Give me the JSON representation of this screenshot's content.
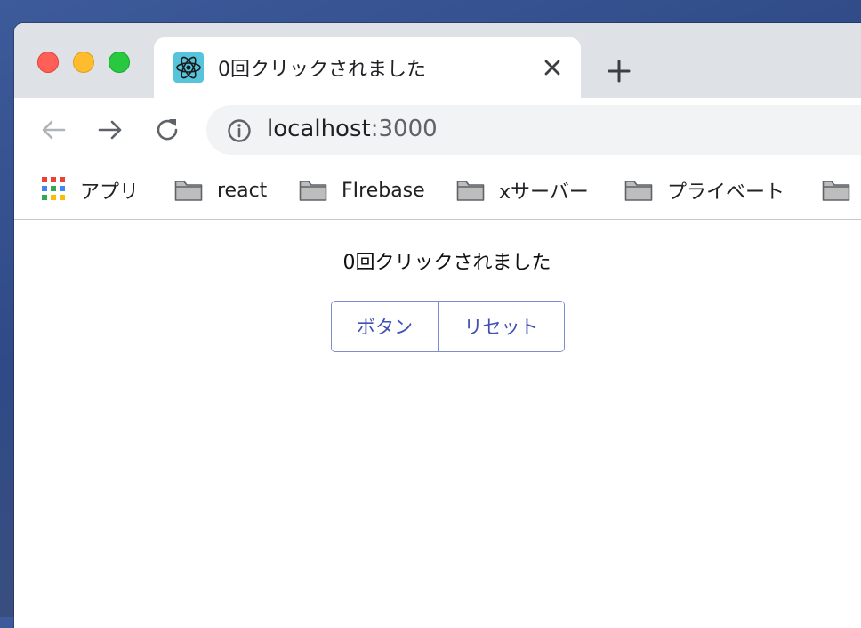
{
  "tab": {
    "title": "0回クリックされました",
    "favicon": "react-icon"
  },
  "address_bar": {
    "host": "localhost",
    "port": ":3000"
  },
  "bookmarks": [
    {
      "label": "アプリ",
      "icon": "apps-grid-icon"
    },
    {
      "label": "react",
      "icon": "folder-icon"
    },
    {
      "label": "FIrebase",
      "icon": "folder-icon"
    },
    {
      "label": "xサーバー",
      "icon": "folder-icon"
    },
    {
      "label": "プライベート",
      "icon": "folder-icon"
    },
    {
      "label": "",
      "icon": "folder-icon"
    }
  ],
  "page": {
    "count_text": "0回クリックされました",
    "buttons": {
      "count_label": "ボタン",
      "reset_label": "リセット"
    }
  },
  "colors": {
    "tabstrip": "#dee1e6",
    "omnibox": "#f1f3f4",
    "button_text": "#3f51b5",
    "button_border": "#7b8fd0",
    "react_blue": "#58c4dc"
  }
}
